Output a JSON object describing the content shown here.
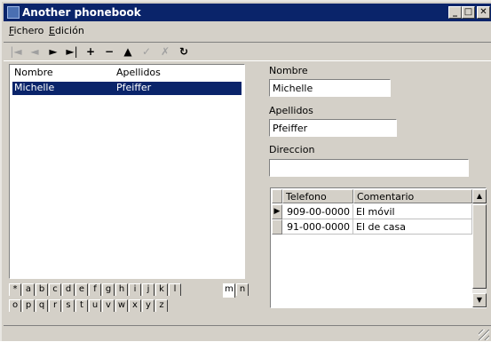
{
  "window": {
    "title": "Another phonebook"
  },
  "menu": [
    {
      "accel": "F",
      "rest": "ichero"
    },
    {
      "accel": "E",
      "rest": "dición"
    }
  ],
  "toolbar": [
    {
      "name": "first-record",
      "glyph": "|◄",
      "enabled": false
    },
    {
      "name": "prior-record",
      "glyph": "◄",
      "enabled": false
    },
    {
      "name": "next-record",
      "glyph": "►",
      "enabled": true
    },
    {
      "name": "last-record",
      "glyph": "►|",
      "enabled": true
    },
    {
      "name": "insert-record",
      "glyph": "+",
      "enabled": true
    },
    {
      "name": "delete-record",
      "glyph": "−",
      "enabled": true
    },
    {
      "name": "edit-record",
      "glyph": "▲",
      "enabled": true
    },
    {
      "name": "post-edit",
      "glyph": "✓",
      "enabled": false
    },
    {
      "name": "cancel-edit",
      "glyph": "✗",
      "enabled": false
    },
    {
      "name": "refresh",
      "glyph": "↻",
      "enabled": true
    }
  ],
  "list": {
    "columns": [
      "Nombre",
      "Apellidos"
    ],
    "rows": [
      {
        "nombre": "Michelle",
        "apellidos": "Pfeiffer",
        "selected": true
      }
    ]
  },
  "alphabet_tabs": {
    "row1": [
      "*",
      "a",
      "b",
      "c",
      "d",
      "e",
      "f",
      "g",
      "h",
      "i",
      "j",
      "k",
      "l",
      "m",
      "n"
    ],
    "row2": [
      "o",
      "p",
      "q",
      "r",
      "s",
      "t",
      "u",
      "v",
      "w",
      "x",
      "y",
      "z"
    ],
    "active": "m"
  },
  "form": {
    "nombre_label": "Nombre",
    "nombre_value": "Michelle",
    "apellidos_label": "Apellidos",
    "apellidos_value": "Pfeiffer",
    "direccion_label": "Direccion",
    "direccion_value": ""
  },
  "phones": {
    "columns": [
      "Telefono",
      "Comentario"
    ],
    "rows": [
      {
        "telefono": "909-00-0000",
        "comentario": "El móvil",
        "current": true
      },
      {
        "telefono": "91-000-0000",
        "comentario": "El de casa",
        "current": false
      }
    ]
  },
  "colors": {
    "titlebar": "#0a246a",
    "selection": "#0a246a",
    "face": "#d4d0c8"
  }
}
